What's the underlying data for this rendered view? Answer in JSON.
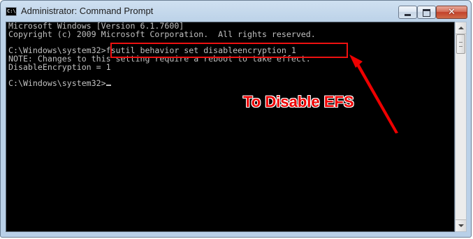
{
  "window": {
    "icon_text": "C:\\",
    "title": "Administrator: Command Prompt",
    "close_glyph": "✕"
  },
  "console": {
    "lines": [
      "Microsoft Windows [Version 6.1.7600]",
      "Copyright (c) 2009 Microsoft Corporation.  All rights reserved.",
      "",
      "C:\\Windows\\system32>fsutil behavior set disableencryption 1",
      "NOTE: Changes to this setting require a reboot to take effect.",
      "DisableEncryption = 1",
      "",
      "C:\\Windows\\system32>"
    ]
  },
  "annotation": {
    "label": "To Disable EFS",
    "color": "#e00000"
  }
}
